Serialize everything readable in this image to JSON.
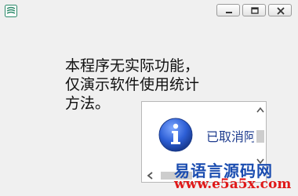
{
  "window": {
    "icons": {
      "app": "app-logo-icon",
      "minimize": "minimize-icon",
      "maximize": "maximize-icon",
      "close": "close-icon"
    }
  },
  "content": {
    "lines": [
      "本程序无实际功能，",
      "仅演示软件使用统计",
      "方法。"
    ]
  },
  "notification": {
    "icon": "info-icon",
    "message": "已取消阿"
  },
  "watermark": {
    "line1": "易语言源码网",
    "line2": "www.e5a5x.com"
  },
  "colors": {
    "message_text": "#1e3c8e",
    "watermark_blue": "#1b4db0",
    "watermark_red": "#e01818"
  }
}
